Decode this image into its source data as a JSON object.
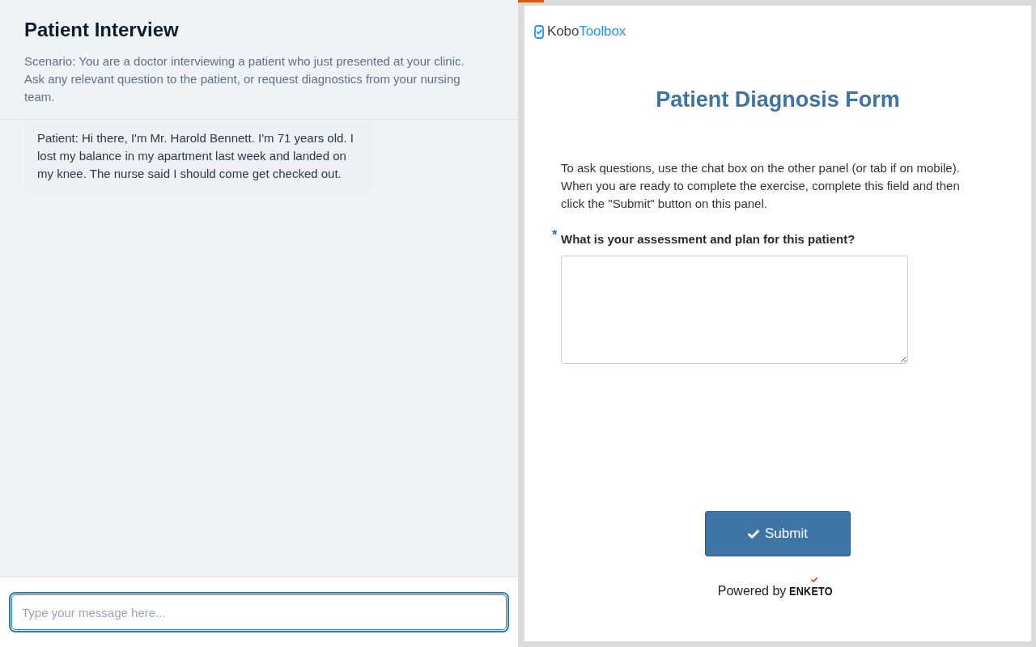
{
  "chat_panel": {
    "title": "Patient Interview",
    "scenario": "Scenario: You are a doctor interviewing a patient who just presented at your clinic. Ask any relevant question to the patient, or request diagnostics from your nursing team.",
    "messages": [
      {
        "text": "Patient: Hi there, I'm Mr. Harold Bennett. I'm 71 years old. I lost my balance in my apartment last week and landed on my knee. The nurse said I should come get checked out."
      }
    ],
    "message_input": {
      "placeholder": "Type your message here...",
      "focused": true
    }
  },
  "form_panel": {
    "progress": {
      "level": 0.05
    },
    "logo": {
      "dark_part": "Kobo",
      "accent_part": "Toolbox"
    },
    "title": "Patient Diagnosis Form",
    "instructions": "To ask questions, use the chat box on the other panel (or tab if on mobile). When you are ready to complete the exercise, complete this field and then click the \"Submit\" button on this panel.",
    "question": {
      "required_mark": "*",
      "label": "What is your assessment and plan for this patient?"
    },
    "submit_button": {
      "label": "Submit"
    },
    "footer": {
      "powered_by": "Powered by",
      "brand": "ENKETO"
    }
  }
}
